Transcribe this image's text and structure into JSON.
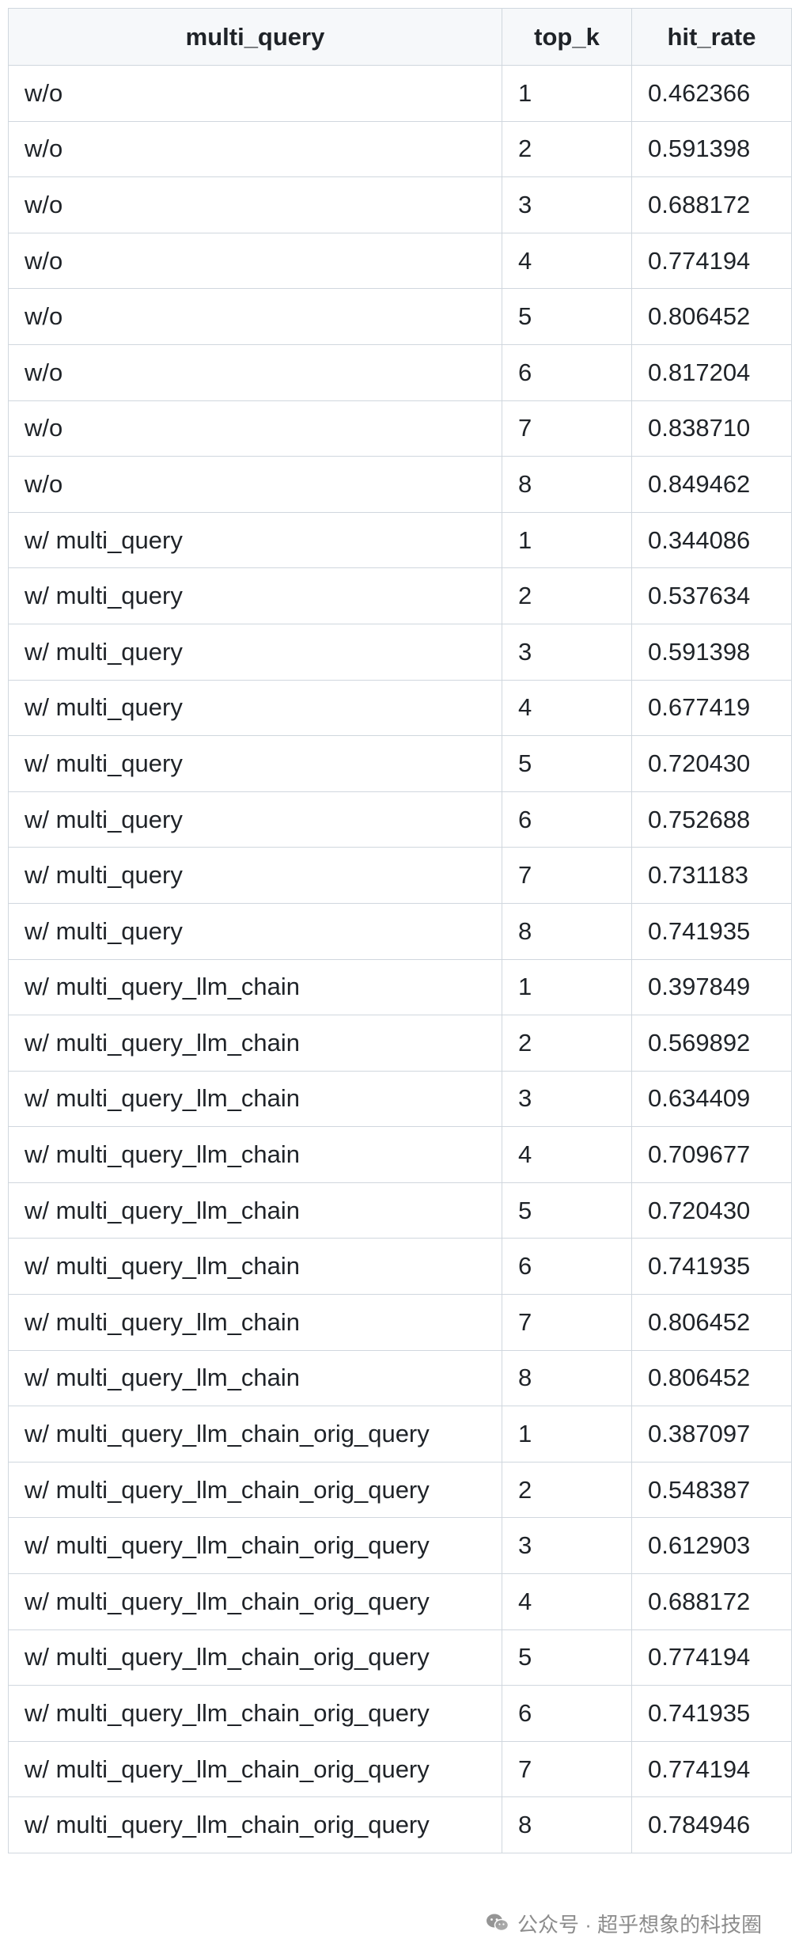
{
  "table": {
    "headers": [
      "multi_query",
      "top_k",
      "hit_rate"
    ],
    "rows": [
      [
        "w/o",
        "1",
        "0.462366"
      ],
      [
        "w/o",
        "2",
        "0.591398"
      ],
      [
        "w/o",
        "3",
        "0.688172"
      ],
      [
        "w/o",
        "4",
        "0.774194"
      ],
      [
        "w/o",
        "5",
        "0.806452"
      ],
      [
        "w/o",
        "6",
        "0.817204"
      ],
      [
        "w/o",
        "7",
        "0.838710"
      ],
      [
        "w/o",
        "8",
        "0.849462"
      ],
      [
        "w/ multi_query",
        "1",
        "0.344086"
      ],
      [
        "w/ multi_query",
        "2",
        "0.537634"
      ],
      [
        "w/ multi_query",
        "3",
        "0.591398"
      ],
      [
        "w/ multi_query",
        "4",
        "0.677419"
      ],
      [
        "w/ multi_query",
        "5",
        "0.720430"
      ],
      [
        "w/ multi_query",
        "6",
        "0.752688"
      ],
      [
        "w/ multi_query",
        "7",
        "0.731183"
      ],
      [
        "w/ multi_query",
        "8",
        "0.741935"
      ],
      [
        "w/ multi_query_llm_chain",
        "1",
        "0.397849"
      ],
      [
        "w/ multi_query_llm_chain",
        "2",
        "0.569892"
      ],
      [
        "w/ multi_query_llm_chain",
        "3",
        "0.634409"
      ],
      [
        "w/ multi_query_llm_chain",
        "4",
        "0.709677"
      ],
      [
        "w/ multi_query_llm_chain",
        "5",
        "0.720430"
      ],
      [
        "w/ multi_query_llm_chain",
        "6",
        "0.741935"
      ],
      [
        "w/ multi_query_llm_chain",
        "7",
        "0.806452"
      ],
      [
        "w/ multi_query_llm_chain",
        "8",
        "0.806452"
      ],
      [
        "w/ multi_query_llm_chain_orig_query",
        "1",
        "0.387097"
      ],
      [
        "w/ multi_query_llm_chain_orig_query",
        "2",
        "0.548387"
      ],
      [
        "w/ multi_query_llm_chain_orig_query",
        "3",
        "0.612903"
      ],
      [
        "w/ multi_query_llm_chain_orig_query",
        "4",
        "0.688172"
      ],
      [
        "w/ multi_query_llm_chain_orig_query",
        "5",
        "0.774194"
      ],
      [
        "w/ multi_query_llm_chain_orig_query",
        "6",
        "0.741935"
      ],
      [
        "w/ multi_query_llm_chain_orig_query",
        "7",
        "0.774194"
      ],
      [
        "w/ multi_query_llm_chain_orig_query",
        "8",
        "0.784946"
      ]
    ]
  },
  "watermark": {
    "icon": "wechat-icon",
    "text": "公众号 · 超乎想象的科技圈"
  }
}
